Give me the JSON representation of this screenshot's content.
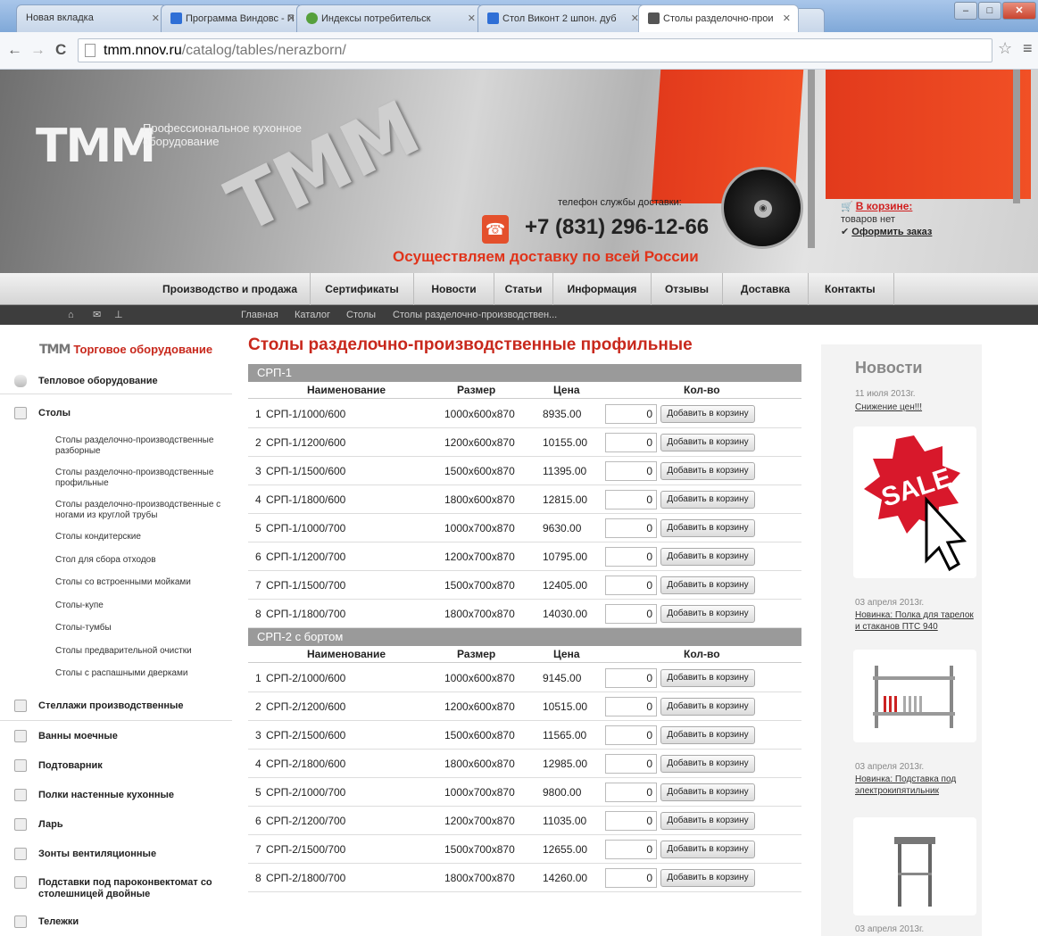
{
  "browser": {
    "tabs": [
      {
        "title": "Новая вкладка"
      },
      {
        "title": "Программа Виндовс - П"
      },
      {
        "title": "Индексы потребительск"
      },
      {
        "title": "Стол Виконт 2 шпон. дуб"
      },
      {
        "title": "Столы разделочно-прои"
      }
    ],
    "url_host": "tmm.nnov.ru",
    "url_path": "/catalog/tables/nerazborn/"
  },
  "banner": {
    "logo": "ТММ",
    "slogan": "Профессиональное кухонное оборудование",
    "phone_label": "телефон службы доставки:",
    "phone": "+7 (831) 296-12-66",
    "delivery": "Осуществляем доставку по всей России",
    "cart_link": "В корзине:",
    "cart_status": "товаров нет",
    "order_link": "Оформить заказ"
  },
  "menu": [
    "Производство и продажа",
    "Сертификаты",
    "Новости",
    "Статьи",
    "Информация",
    "Отзывы",
    "Доставка",
    "Контакты"
  ],
  "breadcrumb": [
    "Главная",
    "Каталог",
    "Столы",
    "Столы разделочно-производствен..."
  ],
  "sidebar": {
    "brand": "ТММ",
    "heading": "Торговое оборудование",
    "categories_top": [
      "Тепловое оборудование",
      "Столы"
    ],
    "subcategories": [
      "Столы разделочно-производственные разборные",
      "Столы разделочно-производственные профильные",
      "Столы разделочно-производственные с ногами из круглой трубы",
      "Столы кондитерские",
      "Стол для сбора отходов",
      "Столы со встроенными мойками",
      "Столы-купе",
      "Столы-тумбы",
      "Столы предварительной очистки",
      "Столы с распашными дверками"
    ],
    "categories_bottom": [
      "Стеллажи производственные",
      "Ванны моечные",
      "Подтоварник",
      "Полки настенные кухонные",
      "Ларь",
      "Зонты вентиляционные",
      "Подставки под пароконвектомат со столешницей двойные",
      "Тележки"
    ]
  },
  "page_title": "Столы разделочно-производственные профильные",
  "table_headers": {
    "name": "Наименование",
    "size": "Размер",
    "price": "Цена",
    "qty": "Кол-во"
  },
  "add_label": "Добавить в корзину",
  "groups": [
    {
      "title": "СРП-1",
      "rows": [
        {
          "n": "1",
          "name": "СРП-1/1000/600",
          "size": "1000x600x870",
          "price": "8935.00",
          "qty": "0"
        },
        {
          "n": "2",
          "name": "СРП-1/1200/600",
          "size": "1200x600x870",
          "price": "10155.00",
          "qty": "0"
        },
        {
          "n": "3",
          "name": "СРП-1/1500/600",
          "size": "1500x600x870",
          "price": "11395.00",
          "qty": "0"
        },
        {
          "n": "4",
          "name": "СРП-1/1800/600",
          "size": "1800x600x870",
          "price": "12815.00",
          "qty": "0"
        },
        {
          "n": "5",
          "name": "СРП-1/1000/700",
          "size": "1000x700x870",
          "price": "9630.00",
          "qty": "0"
        },
        {
          "n": "6",
          "name": "СРП-1/1200/700",
          "size": "1200x700x870",
          "price": "10795.00",
          "qty": "0"
        },
        {
          "n": "7",
          "name": "СРП-1/1500/700",
          "size": "1500x700x870",
          "price": "12405.00",
          "qty": "0"
        },
        {
          "n": "8",
          "name": "СРП-1/1800/700",
          "size": "1800x700x870",
          "price": "14030.00",
          "qty": "0"
        }
      ]
    },
    {
      "title": "СРП-2 с бортом",
      "rows": [
        {
          "n": "1",
          "name": "СРП-2/1000/600",
          "size": "1000x600x870",
          "price": "9145.00",
          "qty": "0"
        },
        {
          "n": "2",
          "name": "СРП-2/1200/600",
          "size": "1200x600x870",
          "price": "10515.00",
          "qty": "0"
        },
        {
          "n": "3",
          "name": "СРП-2/1500/600",
          "size": "1500x600x870",
          "price": "11565.00",
          "qty": "0"
        },
        {
          "n": "4",
          "name": "СРП-2/1800/600",
          "size": "1800x600x870",
          "price": "12985.00",
          "qty": "0"
        },
        {
          "n": "5",
          "name": "СРП-2/1000/700",
          "size": "1000x700x870",
          "price": "9800.00",
          "qty": "0"
        },
        {
          "n": "6",
          "name": "СРП-2/1200/700",
          "size": "1200x700x870",
          "price": "11035.00",
          "qty": "0"
        },
        {
          "n": "7",
          "name": "СРП-2/1500/700",
          "size": "1500x700x870",
          "price": "12655.00",
          "qty": "0"
        },
        {
          "n": "8",
          "name": "СРП-2/1800/700",
          "size": "1800x700x870",
          "price": "14260.00",
          "qty": "0"
        }
      ]
    }
  ],
  "news": {
    "title": "Новости",
    "items": [
      {
        "date": "11 июля 2013г.",
        "link": "Снижение цен!!!"
      },
      {
        "date": "03 апреля 2013г.",
        "link": "Новинка: Полка для тарелок и стаканов ПТС 940"
      },
      {
        "date": "03 апреля 2013г.",
        "link": "Новинка: Подставка под электрокипятильник"
      },
      {
        "date": "03 апреля 2013г.",
        "link": ""
      }
    ],
    "sale_text": "SALE"
  },
  "colors": {
    "accent_red": "#c8281c",
    "group_bar": "#9a9a9a",
    "crumb_bar": "#3d3d3d"
  }
}
